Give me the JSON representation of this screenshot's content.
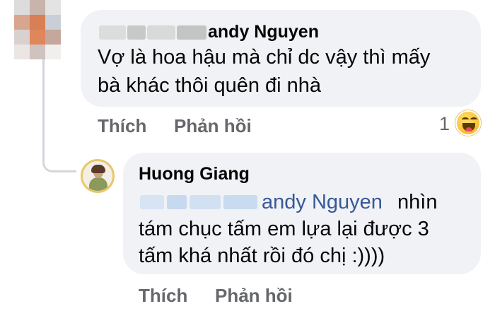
{
  "comment": {
    "author_visible": "andy Nguyen",
    "text_line1": "Vợ là hoa hậu mà chỉ dc vậy thì mấy",
    "text_line2": "bà khác thôi quên đi nhà",
    "like_label": "Thích",
    "reply_label": "Phản hồi",
    "reaction_count": "1",
    "reaction_icon": "haha-icon"
  },
  "reply": {
    "author": "Huong Giang",
    "mention": "andy Nguyen",
    "text_line1_suffix": "nhìn",
    "text_line2": "tám chục tấm em lựa lại được 3",
    "text_line3": "tấm khá nhất rồi đó chị :))))",
    "like_label": "Thích",
    "reply_label": "Phản hồi"
  },
  "colors": {
    "bubble_bg": "#f0f2f5",
    "mention": "#385898",
    "action_gray": "#65676b",
    "text": "#050505"
  }
}
